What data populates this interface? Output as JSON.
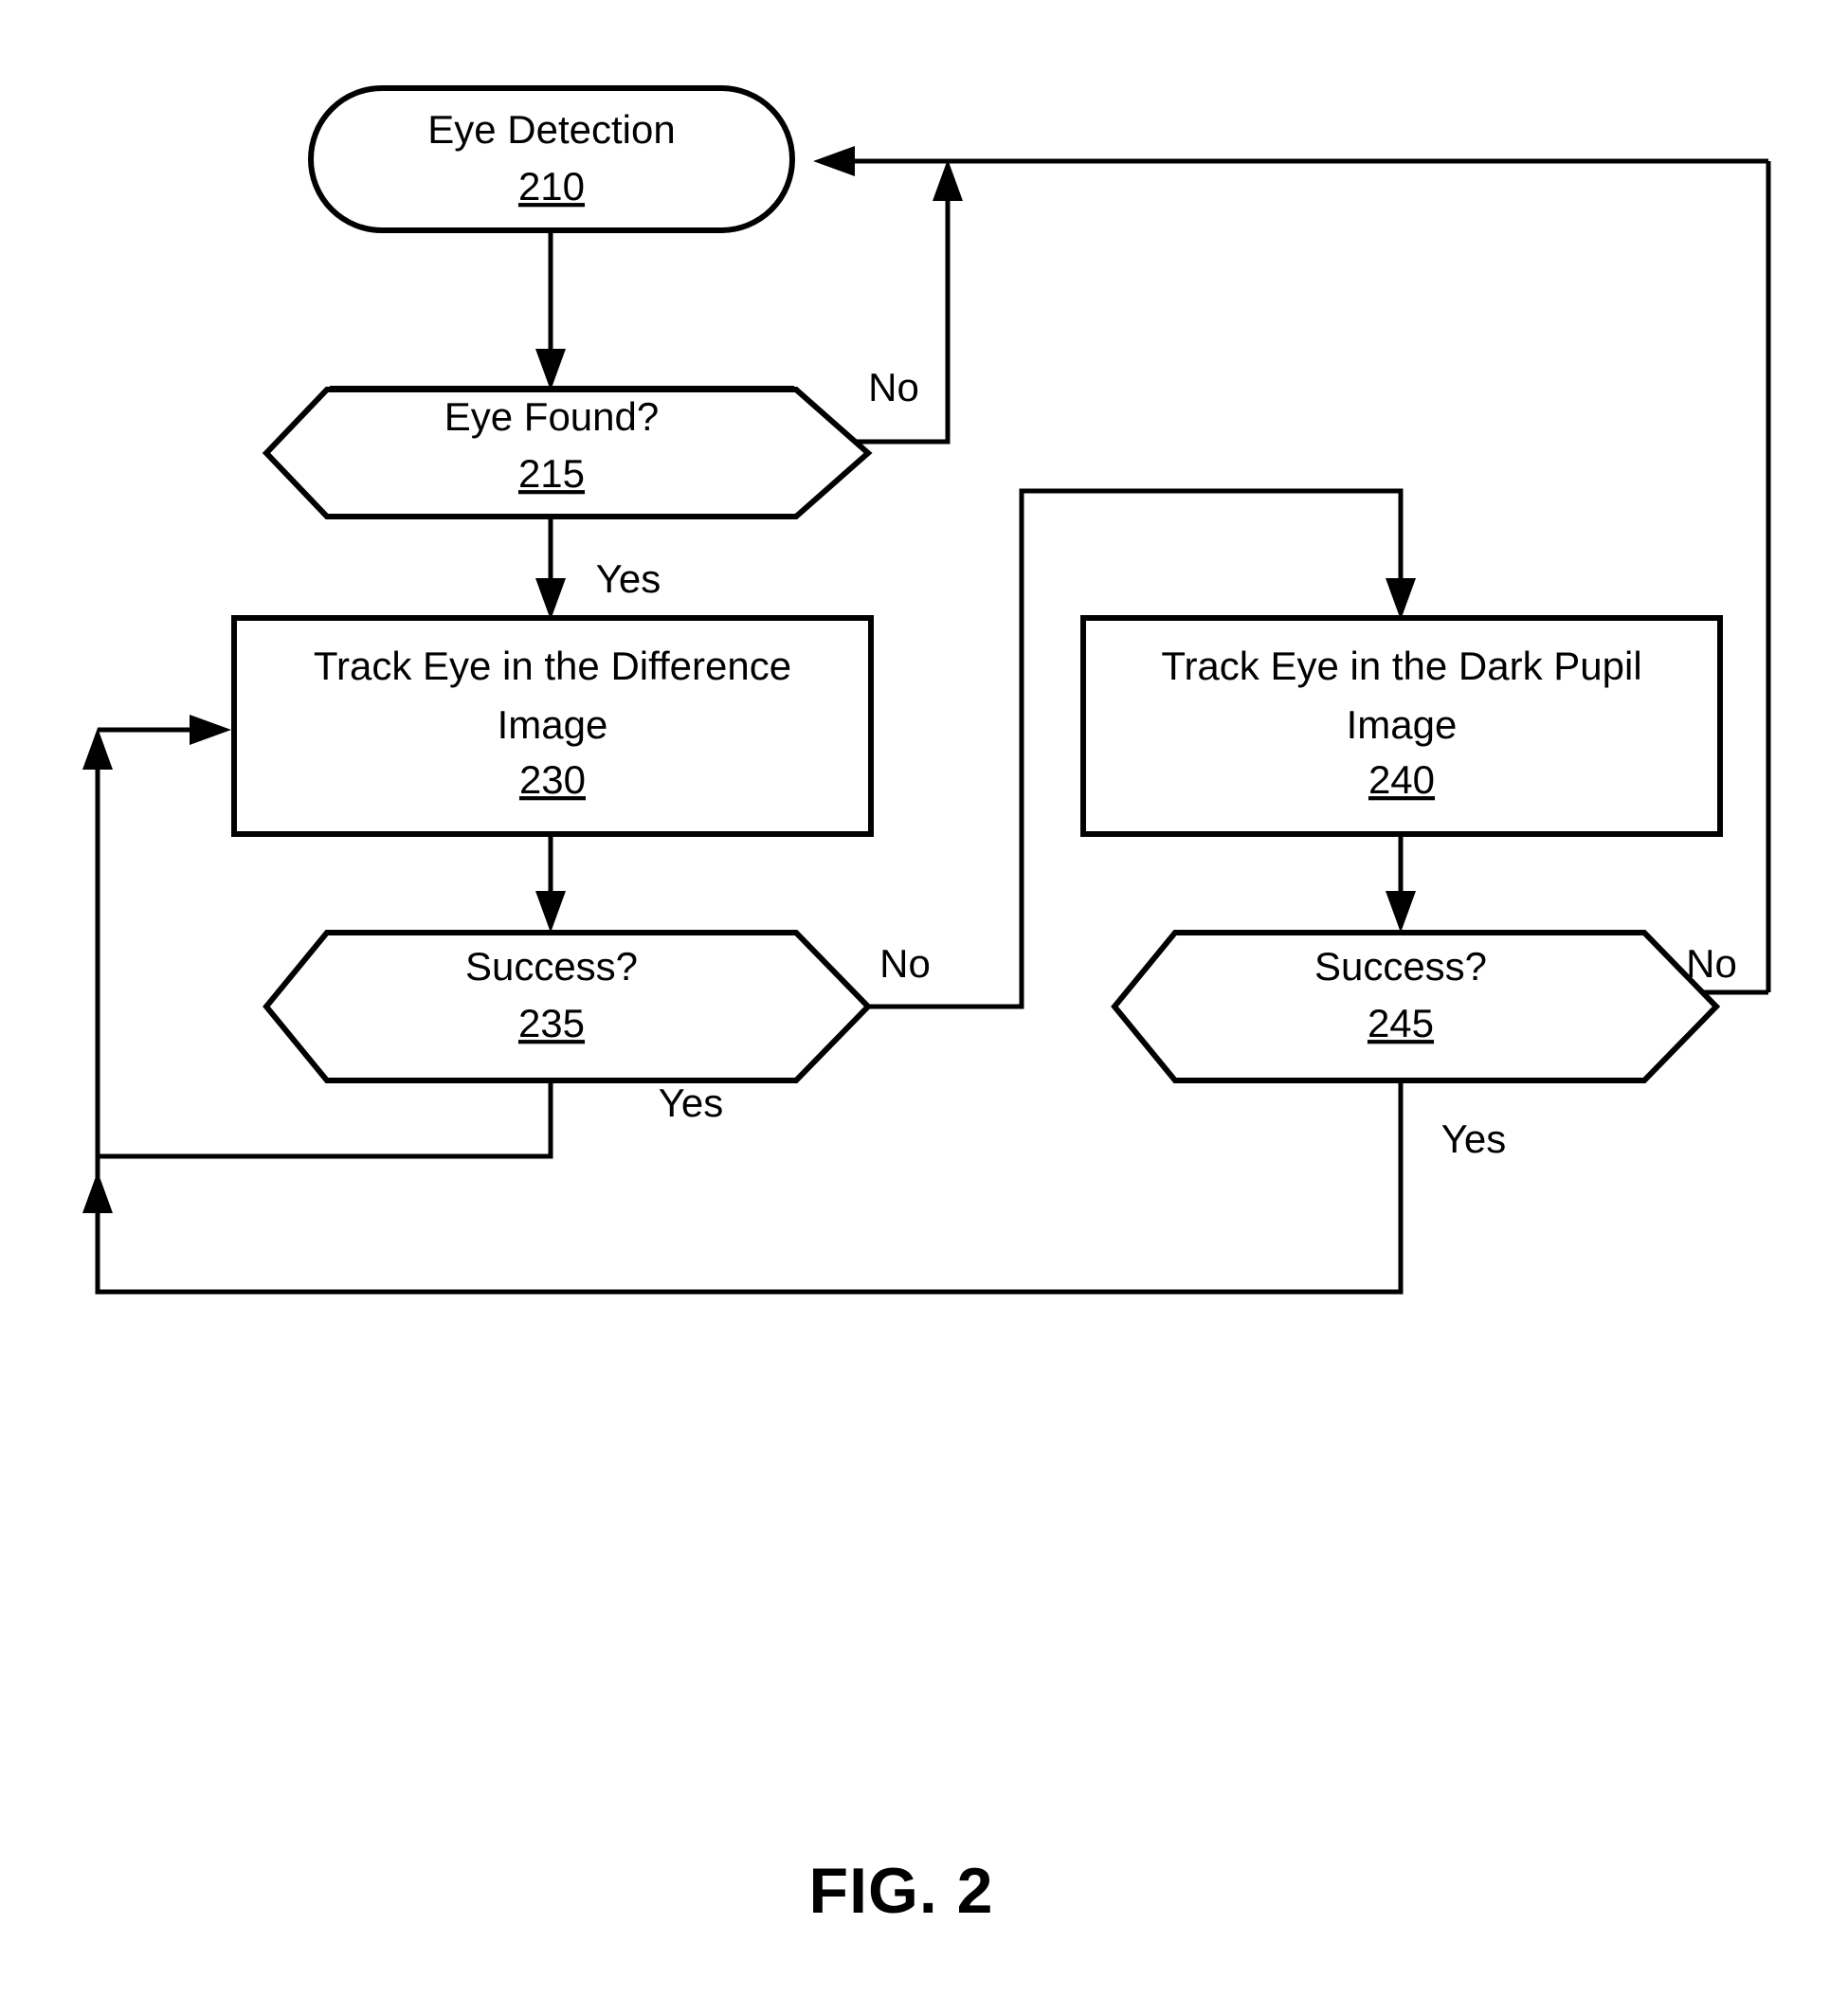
{
  "figure": {
    "caption": "FIG. 2"
  },
  "nodes": {
    "eye_detection": {
      "shape": "rounded-terminator",
      "label": "Eye Detection",
      "ref": "210"
    },
    "eye_found": {
      "shape": "hexagon-decision",
      "label": "Eye Found?",
      "ref": "215"
    },
    "track_difference": {
      "shape": "rectangle-process",
      "label_line1": "Track Eye in the Difference",
      "label_line2": "Image",
      "ref": "230"
    },
    "track_dark_pupil": {
      "shape": "rectangle-process",
      "label_line1": "Track Eye in the Dark Pupil",
      "label_line2": "Image",
      "ref": "240"
    },
    "success_difference": {
      "shape": "hexagon-decision",
      "label": "Success?",
      "ref": "235"
    },
    "success_dark_pupil": {
      "shape": "hexagon-decision",
      "label": "Success?",
      "ref": "245"
    }
  },
  "edge_labels": {
    "eye_found_no": "No",
    "eye_found_yes": "Yes",
    "success_235_no": "No",
    "success_235_yes": "Yes",
    "success_245_no": "No",
    "success_245_yes": "Yes"
  },
  "colors": {
    "stroke": "#000000",
    "fill": "#ffffff",
    "background": "#ffffff"
  }
}
